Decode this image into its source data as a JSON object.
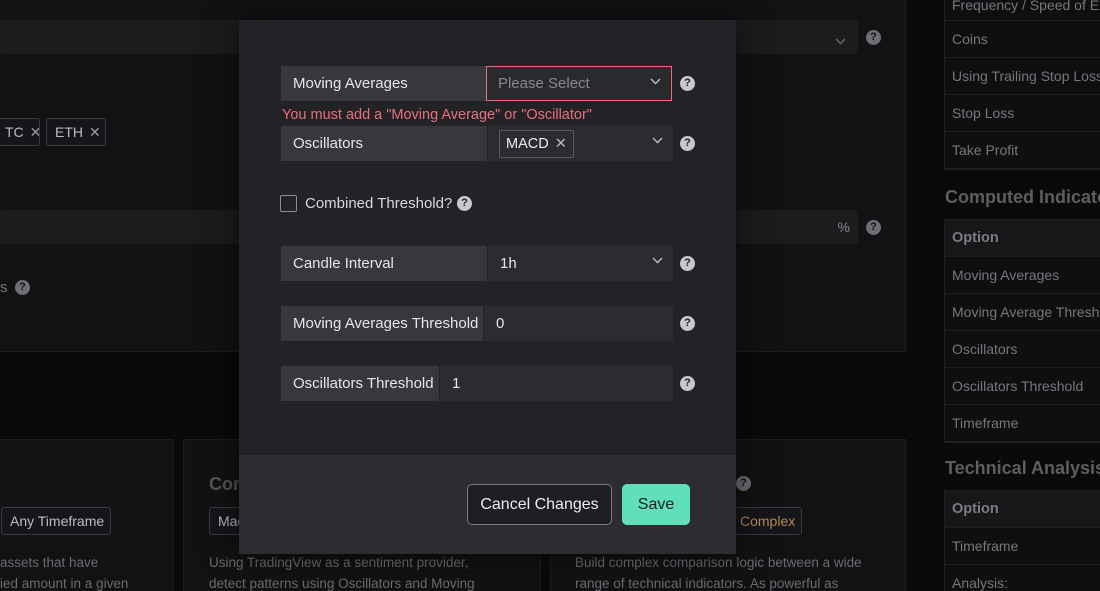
{
  "background": {
    "selected_tags": [
      "TC",
      "ETH"
    ],
    "percent_unit": "%",
    "truncated_label": "s",
    "cards": [
      {
        "tag": "Any Timeframe",
        "desc_line1": "assets that have",
        "desc_line2": "ied amount in a given"
      },
      {
        "title": "Con",
        "tag": "Mac",
        "desc_line1": "Using TradingView as a sentiment provider,",
        "desc_line2": "detect patterns using Oscillators and Moving"
      },
      {
        "tag": "Complex",
        "desc_line1": "Build complex comparison logic between a wide",
        "desc_line2": "range of technical indicators. As powerful as"
      }
    ],
    "right_panel": {
      "top_rows": [
        "Frequency / Speed of Ex",
        "Coins",
        "Using Trailing Stop Loss",
        "Stop Loss",
        "Take Profit"
      ],
      "computed_title": "Computed Indicato",
      "computed_header": "Option",
      "computed_rows": [
        "Moving Averages",
        "Moving Average Thresho",
        "Oscillators",
        "Oscillators Threshold",
        "Timeframe"
      ],
      "ta_title": "Technical Analysis",
      "ta_header": "Option",
      "ta_rows": [
        "Timeframe",
        "Analysis:"
      ]
    }
  },
  "modal": {
    "moving_averages": {
      "label": "Moving Averages",
      "placeholder": "Please Select"
    },
    "error_message": "You must add a \"Moving Average\" or \"Oscillator\"",
    "oscillators": {
      "label": "Oscillators",
      "selected": [
        "MACD"
      ]
    },
    "combined_threshold": {
      "label": "Combined Threshold?",
      "checked": false
    },
    "candle_interval": {
      "label": "Candle Interval",
      "value": "1h"
    },
    "moving_averages_threshold": {
      "label": "Moving Averages Threshold",
      "value": "0"
    },
    "oscillators_threshold": {
      "label": "Oscillators Threshold",
      "value": "1"
    },
    "help_glyph": "?",
    "close_glyph": "✕",
    "buttons": {
      "cancel": "Cancel Changes",
      "save": "Save"
    }
  },
  "colors": {
    "accent": "#5fe0b8",
    "error": "#e8707c",
    "modal_bg": "#232327",
    "page_bg": "#0a0a0b"
  }
}
